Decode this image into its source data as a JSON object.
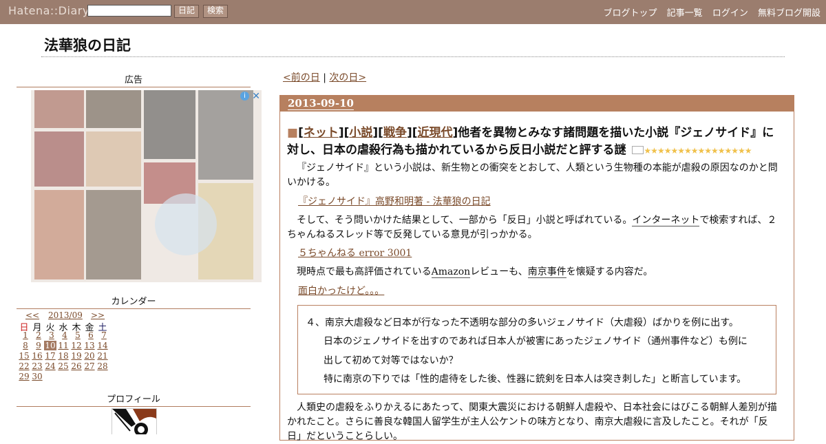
{
  "topbar": {
    "logo": "Hatena::Diary",
    "search_value": "",
    "diary_button": "日記",
    "search_button": "検索",
    "links": [
      "ブログトップ",
      "記事一覧",
      "ログイン",
      "無料ブログ開設"
    ]
  },
  "site_title": "法華狼の日記",
  "sidebar": {
    "ad_heading": "広告",
    "calendar_heading": "カレンダー",
    "profile_heading": "プロフィール",
    "calendar": {
      "prev": "<<",
      "month": "2013/09",
      "next": ">>",
      "weekdays": [
        "日",
        "月",
        "火",
        "水",
        "木",
        "金",
        "土"
      ],
      "weeks": [
        [
          "1",
          "2",
          "3",
          "4",
          "5",
          "6",
          "7"
        ],
        [
          "8",
          "9",
          "10",
          "11",
          "12",
          "13",
          "14"
        ],
        [
          "15",
          "16",
          "17",
          "18",
          "19",
          "20",
          "21"
        ],
        [
          "22",
          "23",
          "24",
          "25",
          "26",
          "27",
          "28"
        ],
        [
          "29",
          "30"
        ]
      ],
      "today": "10"
    }
  },
  "entry": {
    "prev_day": "<前の日",
    "separator": "|",
    "next_day": "次の日>",
    "date": "2013-09-10",
    "tag_marker": "■",
    "tags": [
      "ネット",
      "小説",
      "戦争",
      "近現代"
    ],
    "title": "他者を異物とみなす諸問題を描いた小説『ジェノサイド』に対し、日本の虐殺行為も描かれているから反日小説だと評する謎",
    "stars": "★★★★★★★★★★★★★★★★",
    "p1": "『ジェノサイド』という小説は、新生物との衝突をとおして、人類という生物種の本能が虐殺の原因なのかと問いかける。",
    "link1": "『ジェノサイド』高野和明著 - 法華狼の日記",
    "p2_a": "そして、そう問いかけた結果として、一部から「反日」小説と呼ばれている。",
    "p2_kw": "インターネット",
    "p2_b": "で検索すれば、２ちゃんねるスレッド等で反発している意見が引っかかる。",
    "link2": "５ちゃんねる error 3001",
    "p3_a": "現時点で最も高評価されている",
    "p3_kw1": "Amazon",
    "p3_b": "レビューも、",
    "p3_kw2": "南京事件",
    "p3_c": "を懐疑する内容だ。",
    "link3": "面白かったけど。。。",
    "quote_lines": [
      "４、南京大虐殺など日本が行なった不透明な部分の多いジェノサイド（大虐殺）ばかりを例に出す。",
      "日本のジェノサイドを出すのであれば日本人が被害にあったジェノサイド（通州事件など）も例に",
      "出して初めて対等ではないか？",
      "特に南京の下りでは「性的虐待をした後、性器に銃剣を日本人は突き刺した」と断言しています。"
    ],
    "p4": "人類史の虐殺をふりかえるにあたって、関東大震災における朝鮮人虐殺や、日本社会にはびこる朝鮮人差別が描かれたこと。さらに善良な韓国人留学生が主人公ケントの味方となり、南京大虐殺に言及したこと。それが「反日」だということらしい。"
  }
}
